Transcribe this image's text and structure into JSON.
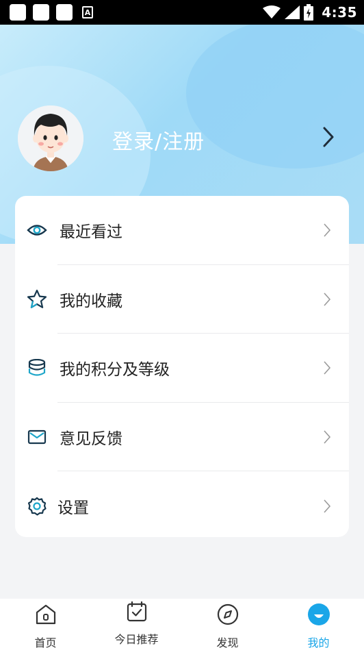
{
  "status_bar": {
    "time": "4:35",
    "notification_icon": "A"
  },
  "profile": {
    "login_label": "登录/注册"
  },
  "menu": {
    "items": [
      {
        "label": "最近看过",
        "icon": "eye-icon"
      },
      {
        "label": "我的收藏",
        "icon": "star-icon"
      },
      {
        "label": "我的积分及等级",
        "icon": "coins-stack-icon"
      },
      {
        "label": "意见反馈",
        "icon": "mail-icon"
      },
      {
        "label": "设置",
        "icon": "gear-icon"
      }
    ]
  },
  "bottom_nav": {
    "items": [
      {
        "label": "首页",
        "icon": "home-icon",
        "active": false
      },
      {
        "label": "今日推荐",
        "icon": "calendar-check-icon",
        "active": false
      },
      {
        "label": "发现",
        "icon": "compass-icon",
        "active": false
      },
      {
        "label": "我的",
        "icon": "profile-face-icon",
        "active": true
      }
    ]
  },
  "colors": {
    "accent": "#1aa6e8",
    "icon_dark": "#17384e",
    "icon_teal": "#1ea6c9",
    "card_bg": "#ffffff",
    "page_bg": "#f3f4f6"
  }
}
